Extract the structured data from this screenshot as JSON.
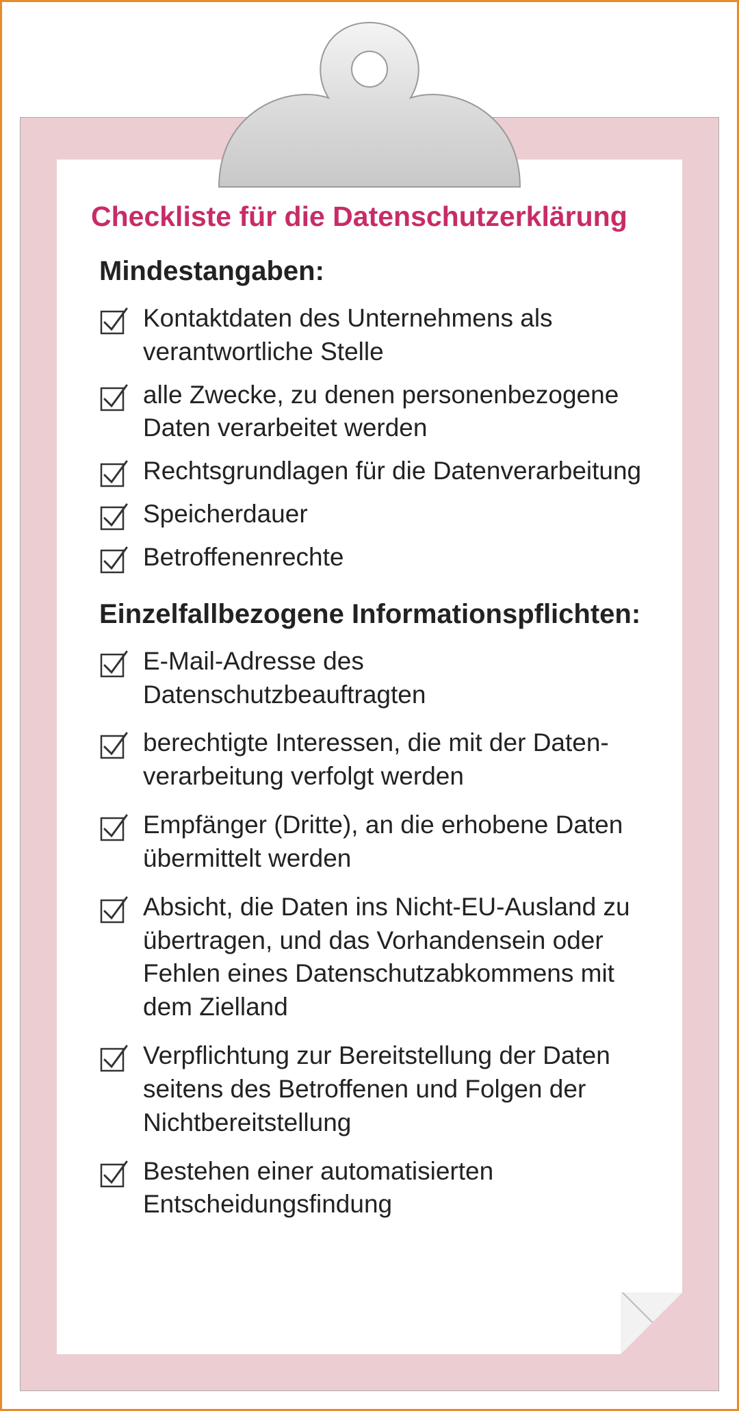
{
  "colors": {
    "accent": "#c72c68",
    "border": "#e88a2a",
    "board": "#eccdd2"
  },
  "title": "Checkliste für die Datenschutzerklärung",
  "sections": [
    {
      "heading": "Mindestangaben:",
      "items": [
        "Kontaktdaten des Unternehmens als verantwortliche Stelle",
        "alle Zwecke, zu denen personenbezogene Daten verarbeitet werden",
        "Rechtsgrundlagen für die Datenverarbeitung",
        "Speicherdauer",
        "Betroffenenrechte"
      ]
    },
    {
      "heading": "Einzelfallbezogene Informationspflichten:",
      "items": [
        "E-Mail-Adresse des Datenschutzbeauftragten",
        "berechtigte Interessen, die mit der Daten­verarbeitung verfolgt werden",
        "Empfänger (Dritte), an die erhobene Daten übermittelt werden",
        "Absicht, die Daten ins Nicht-EU-Ausland zu übertragen, und das Vorhandensein oder Fehlen eines Datenschutzabkommens mit dem Zielland",
        "Verpflichtung zur Bereitstellung der Daten seitens des Betroffenen und Folgen der Nichtbereitstellung",
        "Bestehen einer automatisierten Entscheidungsfindung"
      ]
    }
  ]
}
